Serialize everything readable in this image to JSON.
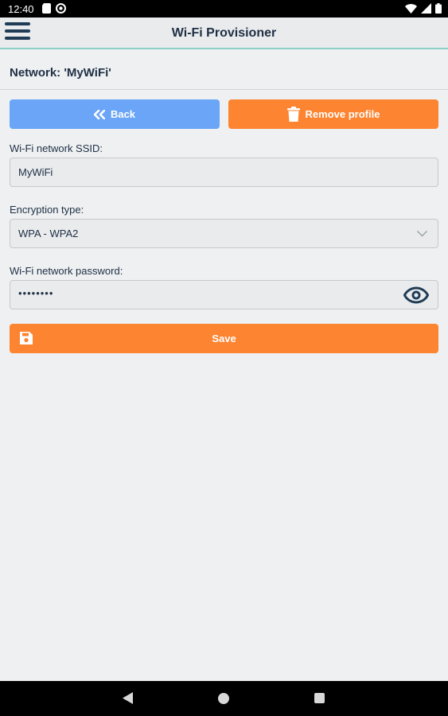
{
  "status_bar": {
    "time": "12:40",
    "icons_left": [
      "sd-card-icon",
      "vpn-icon"
    ],
    "icons_right": [
      "wifi-icon",
      "signal-icon",
      "battery-icon"
    ]
  },
  "app_bar": {
    "title": "Wi-Fi Provisioner",
    "menu_icon": "hamburger-menu-icon"
  },
  "network_header": "Network: 'MyWiFi'",
  "actions": {
    "back_label": "Back",
    "remove_label": "Remove profile",
    "save_label": "Save"
  },
  "form": {
    "ssid_label": "Wi-Fi network SSID:",
    "ssid_value": "MyWiFi",
    "encryption_label": "Encryption type:",
    "encryption_value": "WPA - WPA2",
    "password_label": "Wi-Fi network password:",
    "password_value": "••••••••"
  },
  "colors": {
    "primary_blue": "#6aa5f7",
    "accent_orange": "#fd8431",
    "app_bar_accent": "#8fd1c6",
    "text_dark": "#1f2f45"
  },
  "nav_bar": {
    "icons": [
      "back-triangle-icon",
      "home-circle-icon",
      "recents-square-icon"
    ]
  }
}
